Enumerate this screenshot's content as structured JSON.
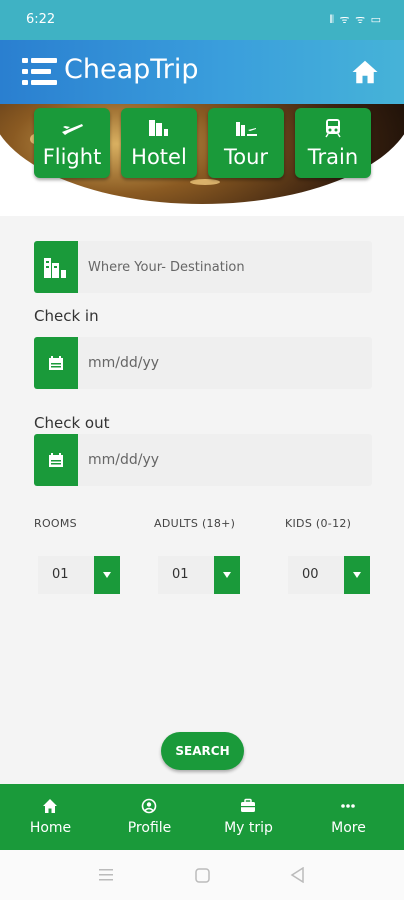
{
  "status": {
    "time": "6:22",
    "system_icons": "⦀ ᯤ ᯤ ▭"
  },
  "app": {
    "title": "CheapTrip"
  },
  "categories": [
    {
      "label": "Flight",
      "icon": "airplane-icon"
    },
    {
      "label": "Hotel",
      "icon": "hotel-icon"
    },
    {
      "label": "Tour",
      "icon": "tour-icon"
    },
    {
      "label": "Train",
      "icon": "train-icon"
    }
  ],
  "form": {
    "destination_placeholder": "Where Your- Destination",
    "checkin_label": "Check in",
    "checkin_placeholder": "mm/dd/yy",
    "checkout_label": "Check out",
    "checkout_placeholder": "mm/dd/yy",
    "rooms_label": "ROOMS",
    "adults_label": "ADULTS (18+)",
    "kids_label": "KIDS (0-12)",
    "rooms_value": "01",
    "adults_value": "01",
    "kids_value": "00",
    "search_label": "SEARCH"
  },
  "bottom_nav": [
    {
      "label": "Home",
      "icon": "home-icon"
    },
    {
      "label": "Profile",
      "icon": "profile-icon"
    },
    {
      "label": "My trip",
      "icon": "briefcase-icon"
    },
    {
      "label": "More",
      "icon": "more-icon"
    }
  ],
  "colors": {
    "accent": "#1a9a3a",
    "header": "#3a9edc",
    "status_bar": "#3fb2c4"
  }
}
